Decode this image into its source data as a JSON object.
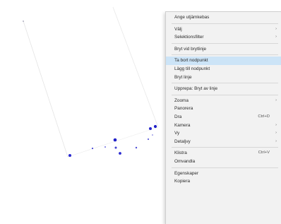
{
  "menu": {
    "items": [
      {
        "type": "item",
        "label": "Ange utjämkebas",
        "shortcut": "",
        "submenu": false
      },
      {
        "type": "separator"
      },
      {
        "type": "item",
        "label": "Välj",
        "shortcut": "",
        "submenu": true
      },
      {
        "type": "item",
        "label": "Selektionsfilter",
        "shortcut": "",
        "submenu": true
      },
      {
        "type": "separator"
      },
      {
        "type": "item",
        "label": "Bryt vid brytlinje",
        "shortcut": "",
        "submenu": false
      },
      {
        "type": "separator"
      },
      {
        "type": "item",
        "label": "Ta bort nodpunkt",
        "shortcut": "",
        "submenu": false,
        "highlighted": true
      },
      {
        "type": "item",
        "label": "Lägg till nodpunkt",
        "shortcut": "",
        "submenu": false
      },
      {
        "type": "item",
        "label": "Bryt linje",
        "shortcut": "",
        "submenu": false
      },
      {
        "type": "separator"
      },
      {
        "type": "item",
        "label": "Upprepa: Bryt av linje",
        "shortcut": "",
        "submenu": false
      },
      {
        "type": "separator"
      },
      {
        "type": "item",
        "label": "Zooma",
        "shortcut": "",
        "submenu": true
      },
      {
        "type": "item",
        "label": "Panorera",
        "shortcut": "",
        "submenu": false
      },
      {
        "type": "item",
        "label": "Dra",
        "shortcut": "Ctrl+D",
        "submenu": false
      },
      {
        "type": "item",
        "label": "Kamera",
        "shortcut": "",
        "submenu": true
      },
      {
        "type": "item",
        "label": "Vy",
        "shortcut": "",
        "submenu": true
      },
      {
        "type": "item",
        "label": "Detaljvy",
        "shortcut": "",
        "submenu": true
      },
      {
        "type": "separator"
      },
      {
        "type": "item",
        "label": "Klistra",
        "shortcut": "Ctrl+V",
        "submenu": false
      },
      {
        "type": "item",
        "label": "Omvandla",
        "shortcut": "",
        "submenu": false
      },
      {
        "type": "separator"
      },
      {
        "type": "item",
        "label": "Egenskaper",
        "shortcut": "",
        "submenu": false
      },
      {
        "type": "item",
        "label": "Kopiera",
        "shortcut": "",
        "submenu": false
      }
    ]
  },
  "canvas": {
    "background": "#ffffff",
    "line_color": "#e2e2e2",
    "point_color": "#1f1fc8"
  }
}
